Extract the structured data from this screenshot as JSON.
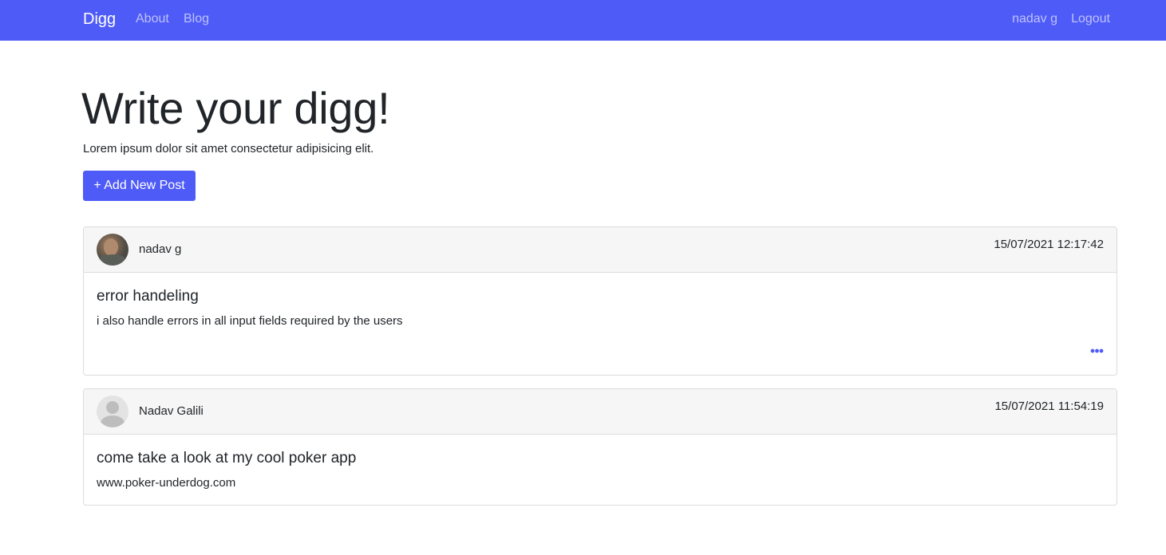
{
  "navbar": {
    "brand": "Digg",
    "links": [
      {
        "label": "About"
      },
      {
        "label": "Blog"
      }
    ],
    "user_name": "nadav g",
    "logout_label": "Logout",
    "color": "#4f5bf7"
  },
  "hero": {
    "title": "Write your digg!",
    "subtitle": "Lorem ipsum dolor sit amet consectetur adipisicing elit.",
    "add_button_label": "+ Add New Post"
  },
  "posts": [
    {
      "author": "nadav g",
      "avatar": "user-photo-avatar",
      "timestamp": "15/07/2021 12:17:42",
      "title": "error handeling",
      "body": "i also handle errors in all input fields required by the users",
      "has_menu": true,
      "menu_icon": "more-horizontal-icon"
    },
    {
      "author": "Nadav Galili",
      "avatar": "default-user-avatar",
      "timestamp": "15/07/2021 11:54:19",
      "title": "come take a look at my cool poker app",
      "body": "www.poker-underdog.com",
      "has_menu": false
    }
  ]
}
